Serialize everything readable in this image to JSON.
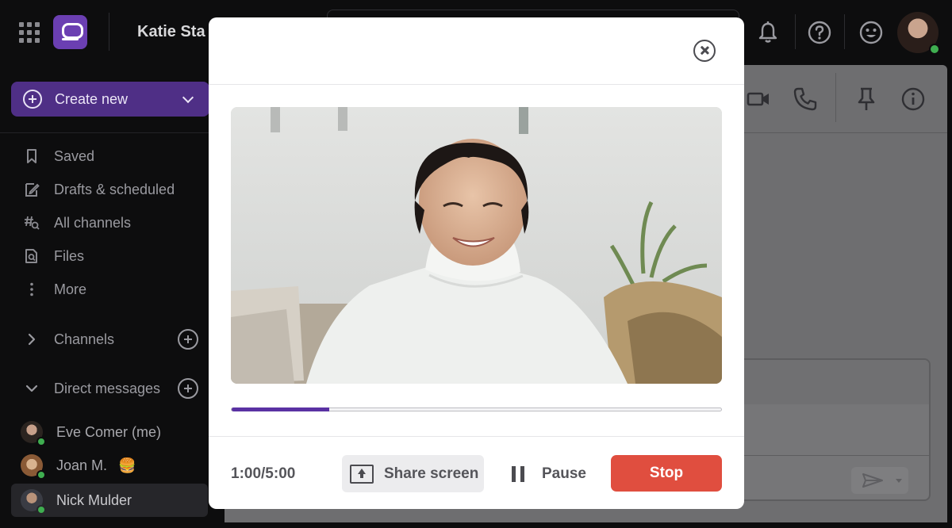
{
  "app": {
    "workspace_name": "Katie Sta",
    "icons": [
      "apps-grid-icon",
      "app-logo-icon",
      "bell-icon",
      "help-icon",
      "emoji-icon"
    ]
  },
  "sidebar": {
    "create_new_label": "Create new",
    "nav_items": [
      {
        "label": "Saved",
        "icon": "bookmark-icon"
      },
      {
        "label": "Drafts & scheduled",
        "icon": "draft-edit-icon"
      },
      {
        "label": "All channels",
        "icon": "channel-search-icon"
      },
      {
        "label": "Files",
        "icon": "file-search-icon"
      },
      {
        "label": "More",
        "icon": "more-vertical-icon"
      }
    ],
    "channels_label": "Channels",
    "direct_messages_label": "Direct messages",
    "dms": [
      {
        "name": "Eve Comer (me)",
        "status": "online"
      },
      {
        "name": "Joan M.",
        "status": "online",
        "emoji": "🍔"
      },
      {
        "name": "Nick Mulder",
        "status": "online",
        "active": true
      }
    ]
  },
  "chat_header": {
    "icons": [
      "video-call-icon",
      "phone-call-icon",
      "pin-icon",
      "info-icon"
    ]
  },
  "recording_modal": {
    "timer": "1:00/5:00",
    "progress": 0.2,
    "share_screen_label": "Share screen",
    "pause_label": "Pause",
    "stop_label": "Stop"
  },
  "colors": {
    "brand_purple": "#6b3fb2",
    "progress_purple": "#5a32a3",
    "stop_red": "#e04e3f",
    "presence_green": "#3fae50"
  }
}
